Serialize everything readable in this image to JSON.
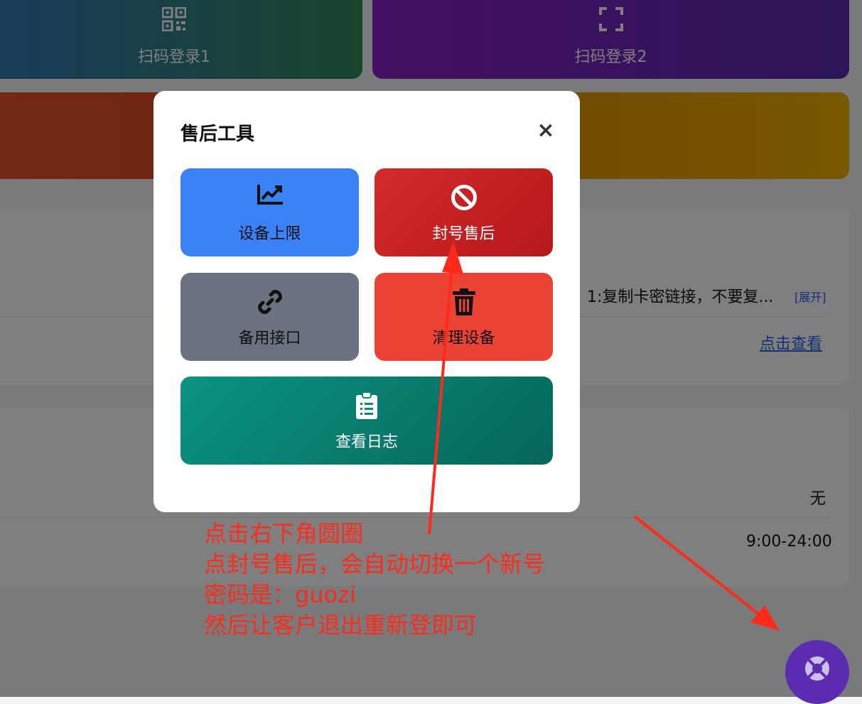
{
  "background": {
    "tiles": [
      {
        "label": "扫码登录1",
        "icon": "qr-code-icon"
      },
      {
        "label": "扫码登录2",
        "icon": "scan-icon"
      }
    ],
    "card1": {
      "notice_text": "1:复制卡密链接，不要复...",
      "expand_label": "[展开]",
      "view_link": "点击查看"
    },
    "card2": {
      "value1": "无",
      "value2": "9:00-24:00"
    },
    "fab_icon": "lifebuoy-icon"
  },
  "modal": {
    "title": "售后工具",
    "close_icon": "close-icon",
    "close_glyph": "×",
    "tools": [
      {
        "label": "设备上限",
        "icon": "chart-line-icon",
        "color": "#3b82f6"
      },
      {
        "label": "封号售后",
        "icon": "ban-icon",
        "color": "#c81e1e"
      },
      {
        "label": "备用接口",
        "icon": "link-icon",
        "color": "#6b7280"
      },
      {
        "label": "清理设备",
        "icon": "trash-icon",
        "color": "#ea4335"
      },
      {
        "label": "查看日志",
        "icon": "clipboard-list-icon",
        "color": "#0b8474"
      }
    ]
  },
  "annotation": {
    "lines": [
      "点击右下角圆圈",
      "点封号售后，会自动切换一个新号",
      "密码是：guozi",
      "然后让客户退出重新登即可"
    ],
    "color": "#ff2a1a"
  }
}
